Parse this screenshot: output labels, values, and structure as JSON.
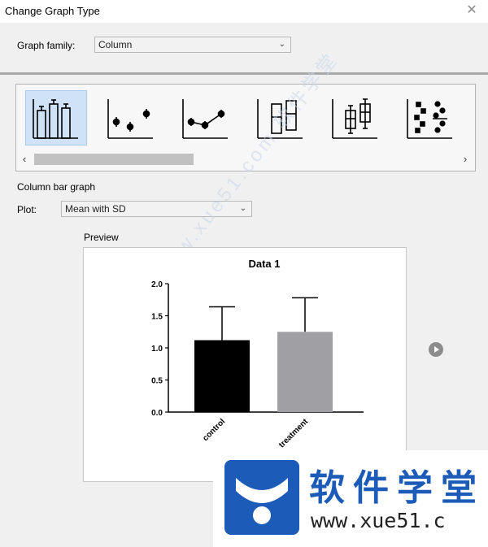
{
  "window": {
    "title": "Change Graph Type"
  },
  "graph_family": {
    "label": "Graph family:",
    "value": "Column"
  },
  "gallery": {
    "thumbnails": [
      {
        "name": "column-bar-graph",
        "selected": true
      },
      {
        "name": "column-scatter-points",
        "selected": false
      },
      {
        "name": "column-connected-points",
        "selected": false
      },
      {
        "name": "column-floating-bars",
        "selected": false
      },
      {
        "name": "column-box-whisker",
        "selected": false
      },
      {
        "name": "column-scatter-dots",
        "selected": false
      }
    ]
  },
  "graph_type_name": "Column bar graph",
  "plot": {
    "label": "Plot:",
    "value": "Mean with SD"
  },
  "preview": {
    "label": "Preview"
  },
  "chart_data": {
    "type": "bar",
    "title": "Data 1",
    "categories": [
      "control",
      "treatment"
    ],
    "values": [
      1.12,
      1.25
    ],
    "errors": [
      0.52,
      0.53
    ],
    "bar_colors": [
      "#000000",
      "#a0a0a4"
    ],
    "ylim": [
      0.0,
      2.0
    ],
    "yticks": [
      "0.0",
      "0.5",
      "1.0",
      "1.5",
      "2.0"
    ]
  },
  "watermark": {
    "text": "软件学堂",
    "url": "www.xue51.c",
    "diag": "www.xue51.com  软件学堂"
  }
}
